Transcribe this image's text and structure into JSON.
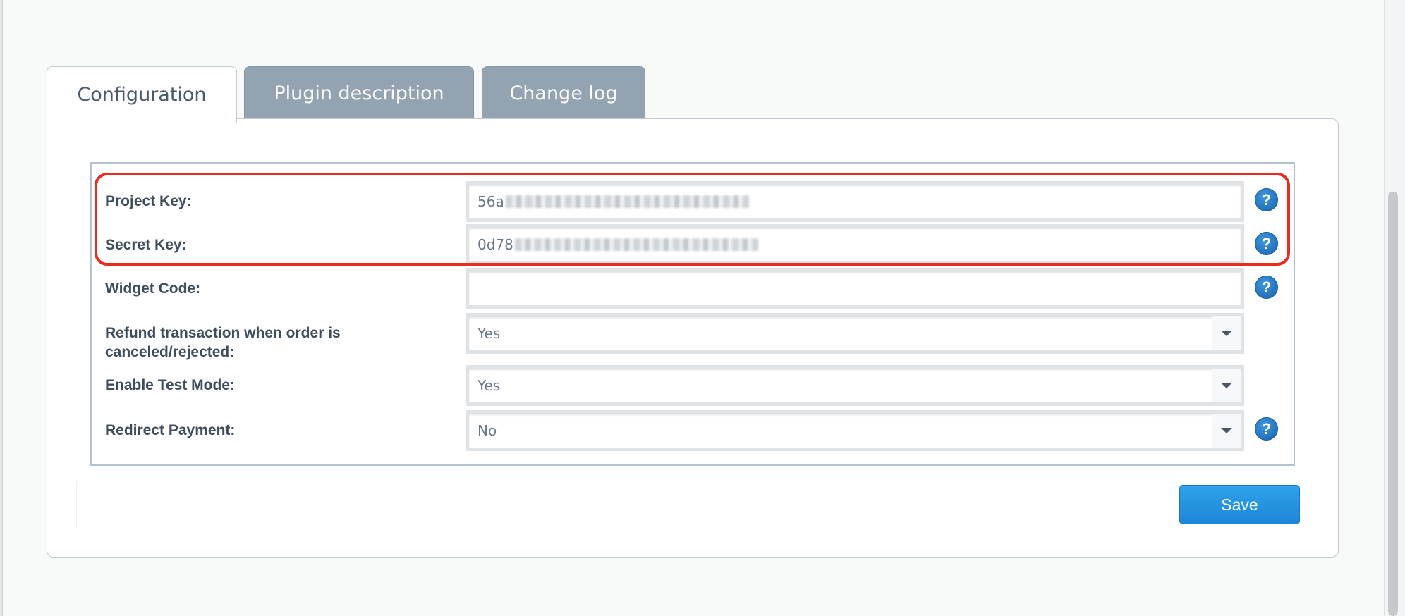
{
  "tabs": [
    {
      "label": "Configuration",
      "active": true
    },
    {
      "label": "Plugin description",
      "active": false
    },
    {
      "label": "Change log",
      "active": false
    }
  ],
  "form": {
    "project_key": {
      "label": "Project Key:",
      "value_prefix": "56a"
    },
    "secret_key": {
      "label": "Secret Key:",
      "value_prefix": "0d78"
    },
    "widget_code": {
      "label": "Widget Code:",
      "value": ""
    },
    "refund": {
      "label": "Refund transaction when order is canceled/rejected:",
      "value": "Yes"
    },
    "test_mode": {
      "label": "Enable Test Mode:",
      "value": "Yes"
    },
    "redirect": {
      "label": "Redirect Payment:",
      "value": "No"
    }
  },
  "help_glyph": "?",
  "save_label": "Save",
  "colors": {
    "highlight": "#ea2b1f",
    "save_button": "#1d86d6",
    "help_icon": "#1862ae",
    "inactive_tab": "#94a3b1"
  },
  "icons": [
    "question-icon",
    "caret-down-icon"
  ]
}
